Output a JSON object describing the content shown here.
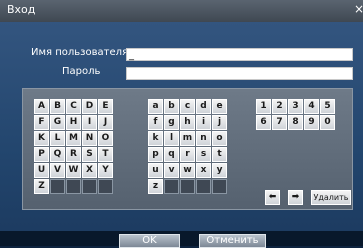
{
  "window": {
    "title": "Вход",
    "close_glyph": "×"
  },
  "form": {
    "username_label": "Имя пользователя",
    "username_value": "_",
    "password_label": "Пароль",
    "password_value": ""
  },
  "keyboard": {
    "uppercase": [
      "A",
      "B",
      "C",
      "D",
      "E",
      "F",
      "G",
      "H",
      "I",
      "J",
      "K",
      "L",
      "M",
      "N",
      "O",
      "P",
      "Q",
      "R",
      "S",
      "T",
      "U",
      "V",
      "W",
      "X",
      "Y",
      "Z"
    ],
    "lowercase": [
      "a",
      "b",
      "c",
      "d",
      "e",
      "f",
      "g",
      "h",
      "i",
      "j",
      "k",
      "l",
      "m",
      "n",
      "o",
      "p",
      "q",
      "r",
      "s",
      "t",
      "u",
      "v",
      "w",
      "x",
      "y",
      "z"
    ],
    "digits": [
      "1",
      "2",
      "3",
      "4",
      "5",
      "6",
      "7",
      "8",
      "9",
      "0"
    ],
    "left_arrow": "⬅",
    "right_arrow": "➡",
    "delete_label": "Удалить"
  },
  "buttons": {
    "ok": "OK",
    "cancel": "Отменить"
  }
}
